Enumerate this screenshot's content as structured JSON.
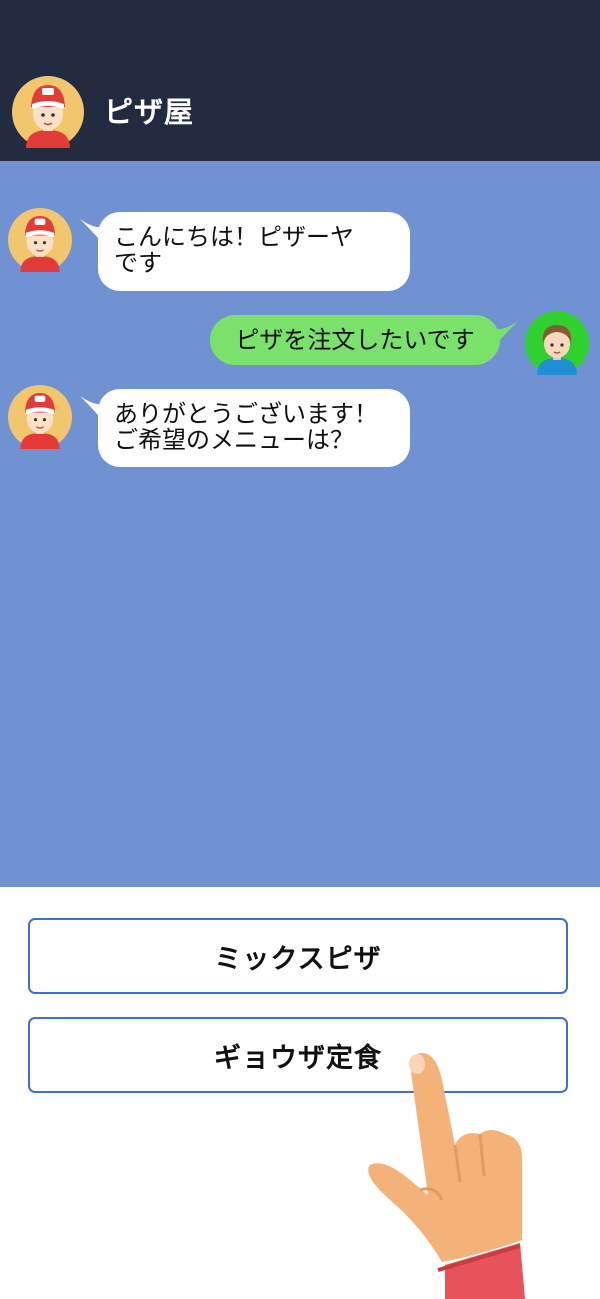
{
  "header": {
    "title": "ピザ屋",
    "avatar_icon": "pizza-shop-staff-avatar-icon"
  },
  "chat": {
    "messages": [
      {
        "sender": "shop",
        "text": "こんにちは！ピザーヤ\nです"
      },
      {
        "sender": "user",
        "text": "ピザを注文したいです"
      },
      {
        "sender": "shop",
        "text": "ありがとうございます！\nご希望のメニューは？"
      }
    ]
  },
  "options": [
    {
      "label": "ミックスピザ"
    },
    {
      "label": "ギョウザ定食"
    }
  ],
  "colors": {
    "header_bg": "#222b40",
    "chat_bg": "#7092d3",
    "incoming_bubble": "#ffffff",
    "outgoing_bubble": "#7ae16a",
    "option_border": "#3e6fd0"
  }
}
